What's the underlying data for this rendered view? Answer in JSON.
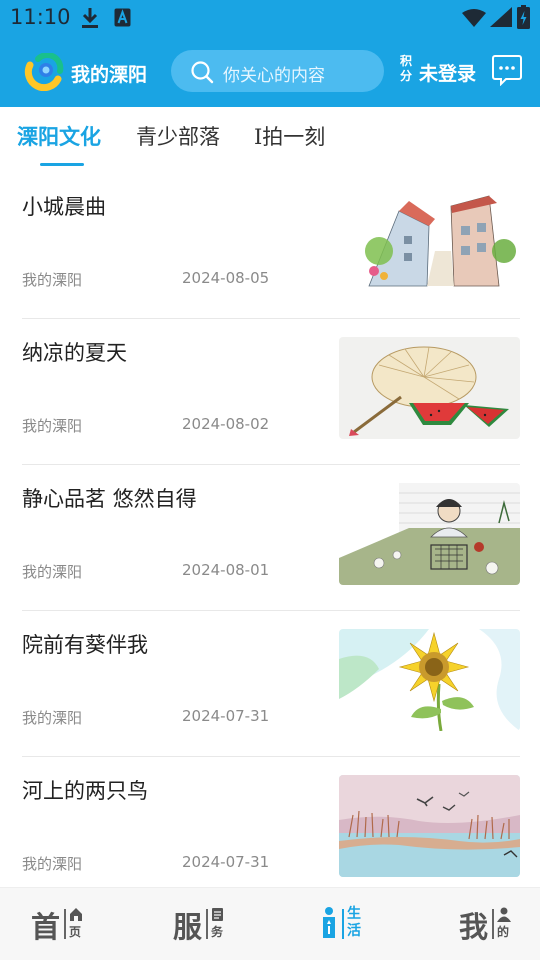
{
  "status_bar": {
    "time": "11:10"
  },
  "header": {
    "app_title": "我的溧阳",
    "search_placeholder": "你关心的内容",
    "points_label": "积分",
    "login_status": "未登录",
    "brand_color": "#1aa4e3"
  },
  "tabs": [
    {
      "label": "溧阳文化",
      "active": true
    },
    {
      "label": "青少部落",
      "active": false
    },
    {
      "label": "I拍一刻",
      "active": false
    }
  ],
  "articles": [
    {
      "title": "小城晨曲",
      "source": "我的溧阳",
      "date": "2024-08-05",
      "thumb": "street-watercolor"
    },
    {
      "title": "纳凉的夏天",
      "source": "我的溧阳",
      "date": "2024-08-02",
      "thumb": "fan-watermelon"
    },
    {
      "title": "静心品茗 悠然自得",
      "source": "我的溧阳",
      "date": "2024-08-01",
      "thumb": "tea-woman"
    },
    {
      "title": "院前有葵伴我",
      "source": "我的溧阳",
      "date": "2024-07-31",
      "thumb": "sunflower"
    },
    {
      "title": "河上的两只鸟",
      "source": "我的溧阳",
      "date": "2024-07-31",
      "thumb": "river-birds"
    }
  ],
  "bottom_nav": [
    {
      "big": "首",
      "small": "页",
      "icon": "home-icon",
      "active": false
    },
    {
      "big": "服",
      "small": "务",
      "icon": "service-icon",
      "active": false
    },
    {
      "big": "i",
      "small": "生活",
      "icon": "life-icon",
      "active": true
    },
    {
      "big": "我",
      "small": "的",
      "icon": "person-icon",
      "active": false
    }
  ]
}
